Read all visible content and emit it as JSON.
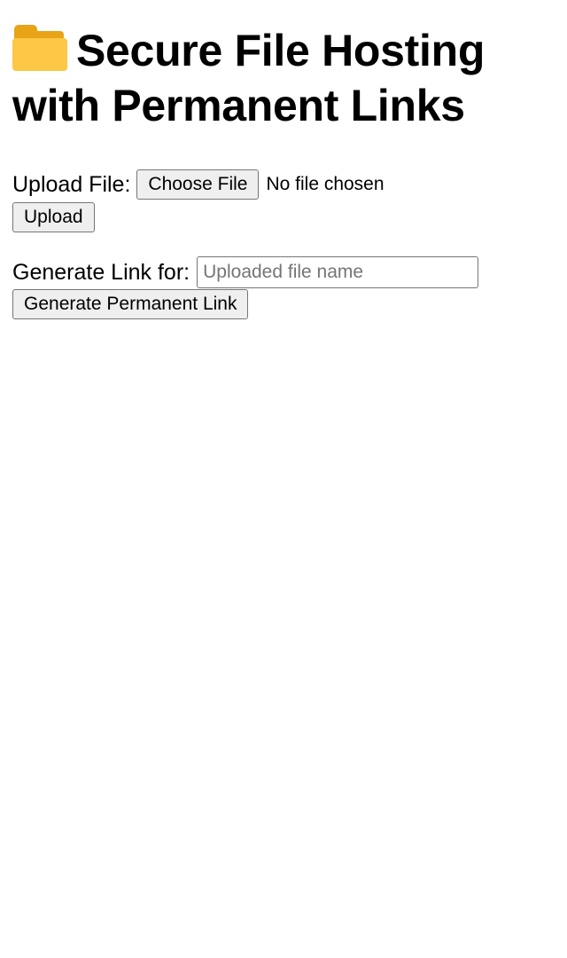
{
  "header": {
    "icon": "folder-icon",
    "title": "Secure File Hosting with Permanent Links"
  },
  "upload": {
    "label": "Upload File:",
    "choose_button": "Choose File",
    "file_status": "No file chosen",
    "upload_button": "Upload"
  },
  "generate": {
    "label": "Generate Link for:",
    "input_placeholder": "Uploaded file name",
    "input_value": "",
    "generate_button": "Generate Permanent Link"
  },
  "colors": {
    "folder_front": "#fcc845",
    "folder_back": "#e8a317"
  }
}
